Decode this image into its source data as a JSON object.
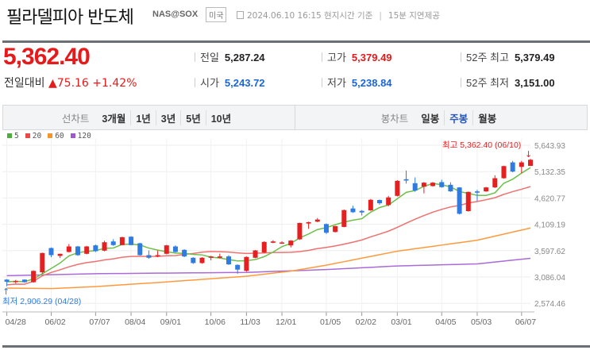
{
  "header": {
    "title": "필라델피아 반도체",
    "code": "NAS@SOX",
    "country": "미국",
    "timestamp": "2024.06.10 16:15 현지시간 기준",
    "delay": "15분 지연제공"
  },
  "quote": {
    "price": "5,362.40",
    "change_label": "전일대비",
    "change": "▲75.16",
    "change_pct": "+1.42%"
  },
  "stats": [
    {
      "label": "전일",
      "value": "5,287.24",
      "color": "normal"
    },
    {
      "label": "고가",
      "value": "5,379.49",
      "color": "red"
    },
    {
      "label": "52주 최고",
      "value": "5,379.49",
      "color": "normal"
    },
    {
      "label": "시가",
      "value": "5,243.72",
      "color": "blue"
    },
    {
      "label": "저가",
      "value": "5,238.84",
      "color": "blue"
    },
    {
      "label": "52주 최저",
      "value": "3,151.00",
      "color": "normal"
    }
  ],
  "tabs": {
    "line_label": "선차트",
    "line_items": [
      "3개월",
      "1년",
      "3년",
      "5년",
      "10년"
    ],
    "candle_label": "봉차트",
    "candle_items": [
      "일봉",
      "주봉",
      "월봉"
    ],
    "candle_selected": "주봉"
  },
  "colors": {
    "up": "#e62020",
    "down": "#2f7be0",
    "ma5": "#6cc04a",
    "ma20": "#f07070",
    "ma60": "#ff9a3c",
    "ma120": "#a96bd6"
  },
  "chart_data": {
    "type": "candlestick",
    "legend": [
      {
        "name": "5",
        "color": "#4caf3a"
      },
      {
        "name": "20",
        "color": "#e84a4a"
      },
      {
        "name": "60",
        "color": "#f5922a"
      },
      {
        "name": "120",
        "color": "#9b59d0"
      }
    ],
    "y_ticks": [
      "5,643.93",
      "5,132.35",
      "4,620.77",
      "4,109.19",
      "3,597.62",
      "3,086.04",
      "2,574.46"
    ],
    "y_tick_values": [
      5643.93,
      5132.35,
      4620.77,
      4109.19,
      3597.62,
      3086.04,
      2574.46
    ],
    "ylim": [
      2574.46,
      5643.93
    ],
    "x_ticks": [
      {
        "i": 0,
        "label": "04/28"
      },
      {
        "i": 5,
        "label": "06/02"
      },
      {
        "i": 10,
        "label": "07/07"
      },
      {
        "i": 14,
        "label": "08/04"
      },
      {
        "i": 18,
        "label": "09/01"
      },
      {
        "i": 23,
        "label": "10/06"
      },
      {
        "i": 27,
        "label": "11/03"
      },
      {
        "i": 31,
        "label": "12/01"
      },
      {
        "i": 36,
        "label": "01/05"
      },
      {
        "i": 40,
        "label": "02/02"
      },
      {
        "i": 44,
        "label": "03/01"
      },
      {
        "i": 49,
        "label": "04/05"
      },
      {
        "i": 53,
        "label": "05/03"
      },
      {
        "i": 58,
        "label": "06/07"
      }
    ],
    "ohlc": [
      [
        3035,
        3045,
        2906,
        2994
      ],
      [
        2990,
        3030,
        2960,
        3010
      ],
      [
        3035,
        3040,
        2975,
        2985
      ],
      [
        2985,
        3215,
        2975,
        3204
      ],
      [
        3178,
        3560,
        3150,
        3551
      ],
      [
        3648,
        3660,
        3470,
        3510
      ],
      [
        3495,
        3540,
        3455,
        3536
      ],
      [
        3572,
        3725,
        3560,
        3679
      ],
      [
        3679,
        3690,
        3495,
        3510
      ],
      [
        3536,
        3690,
        3525,
        3679
      ],
      [
        3700,
        3715,
        3570,
        3587
      ],
      [
        3597,
        3790,
        3585,
        3761
      ],
      [
        3776,
        3820,
        3690,
        3705
      ],
      [
        3705,
        3868,
        3700,
        3858
      ],
      [
        3868,
        3878,
        3700,
        3705
      ],
      [
        3741,
        3750,
        3500,
        3510
      ],
      [
        3510,
        3600,
        3440,
        3459
      ],
      [
        3485,
        3600,
        3470,
        3510
      ],
      [
        3536,
        3710,
        3525,
        3700
      ],
      [
        3679,
        3700,
        3560,
        3572
      ],
      [
        3613,
        3625,
        3470,
        3485
      ],
      [
        3459,
        3470,
        3340,
        3357
      ],
      [
        3357,
        3470,
        3345,
        3459
      ],
      [
        3459,
        3495,
        3410,
        3485
      ],
      [
        3459,
        3540,
        3450,
        3485
      ],
      [
        3485,
        3510,
        3320,
        3331
      ],
      [
        3321,
        3330,
        3151,
        3229
      ],
      [
        3204,
        3485,
        3190,
        3475
      ],
      [
        3459,
        3610,
        3450,
        3602
      ],
      [
        3561,
        3780,
        3550,
        3766
      ],
      [
        3751,
        3800,
        3740,
        3776
      ],
      [
        3735,
        3780,
        3730,
        3756
      ],
      [
        3700,
        3800,
        3660,
        3792
      ],
      [
        3817,
        4140,
        3805,
        4135
      ],
      [
        4124,
        4160,
        4020,
        4150
      ],
      [
        4160,
        4230,
        4150,
        4201
      ],
      [
        4114,
        4125,
        3920,
        3945
      ],
      [
        3960,
        4080,
        3950,
        4073
      ],
      [
        4058,
        4395,
        4050,
        4385
      ],
      [
        4416,
        4470,
        4330,
        4344
      ],
      [
        4370,
        4385,
        4280,
        4339
      ],
      [
        4380,
        4600,
        4370,
        4585
      ],
      [
        4580,
        4590,
        4490,
        4518
      ],
      [
        4482,
        4660,
        4460,
        4631
      ],
      [
        4661,
        4965,
        4650,
        4953
      ],
      [
        4984,
        5152,
        4900,
        4958
      ],
      [
        4907,
        5020,
        4740,
        4764
      ],
      [
        4840,
        4930,
        4710,
        4917
      ],
      [
        4851,
        4930,
        4840,
        4917
      ],
      [
        4928,
        4975,
        4820,
        4830
      ],
      [
        4876,
        4925,
        4740,
        4748
      ],
      [
        4825,
        4830,
        4300,
        4313
      ],
      [
        4365,
        4745,
        4355,
        4738
      ],
      [
        4748,
        4780,
        4560,
        4723
      ],
      [
        4748,
        4835,
        4740,
        4825
      ],
      [
        4825,
        5060,
        4815,
        5004
      ],
      [
        5004,
        5245,
        4995,
        5239
      ],
      [
        5311,
        5340,
        5120,
        5132
      ],
      [
        5224,
        5340,
        5100,
        5311
      ],
      [
        5243.72,
        5379.49,
        5238.84,
        5362.4
      ]
    ],
    "ma60_anchors": [
      [
        0,
        2871
      ],
      [
        5,
        2860
      ],
      [
        10,
        2900
      ],
      [
        18,
        2990
      ],
      [
        27,
        3101
      ],
      [
        32,
        3200
      ],
      [
        36,
        3316
      ],
      [
        44,
        3587
      ],
      [
        53,
        3800
      ],
      [
        59,
        4037
      ]
    ],
    "ma120_anchors": [
      [
        0,
        3111
      ],
      [
        10,
        3150
      ],
      [
        27,
        3175
      ],
      [
        36,
        3230
      ],
      [
        44,
        3300
      ],
      [
        53,
        3340
      ],
      [
        59,
        3449
      ]
    ],
    "annotations": {
      "high": "최고 5,362.40 (06/10)",
      "low": "최저 2,906.29 (04/28)"
    }
  }
}
